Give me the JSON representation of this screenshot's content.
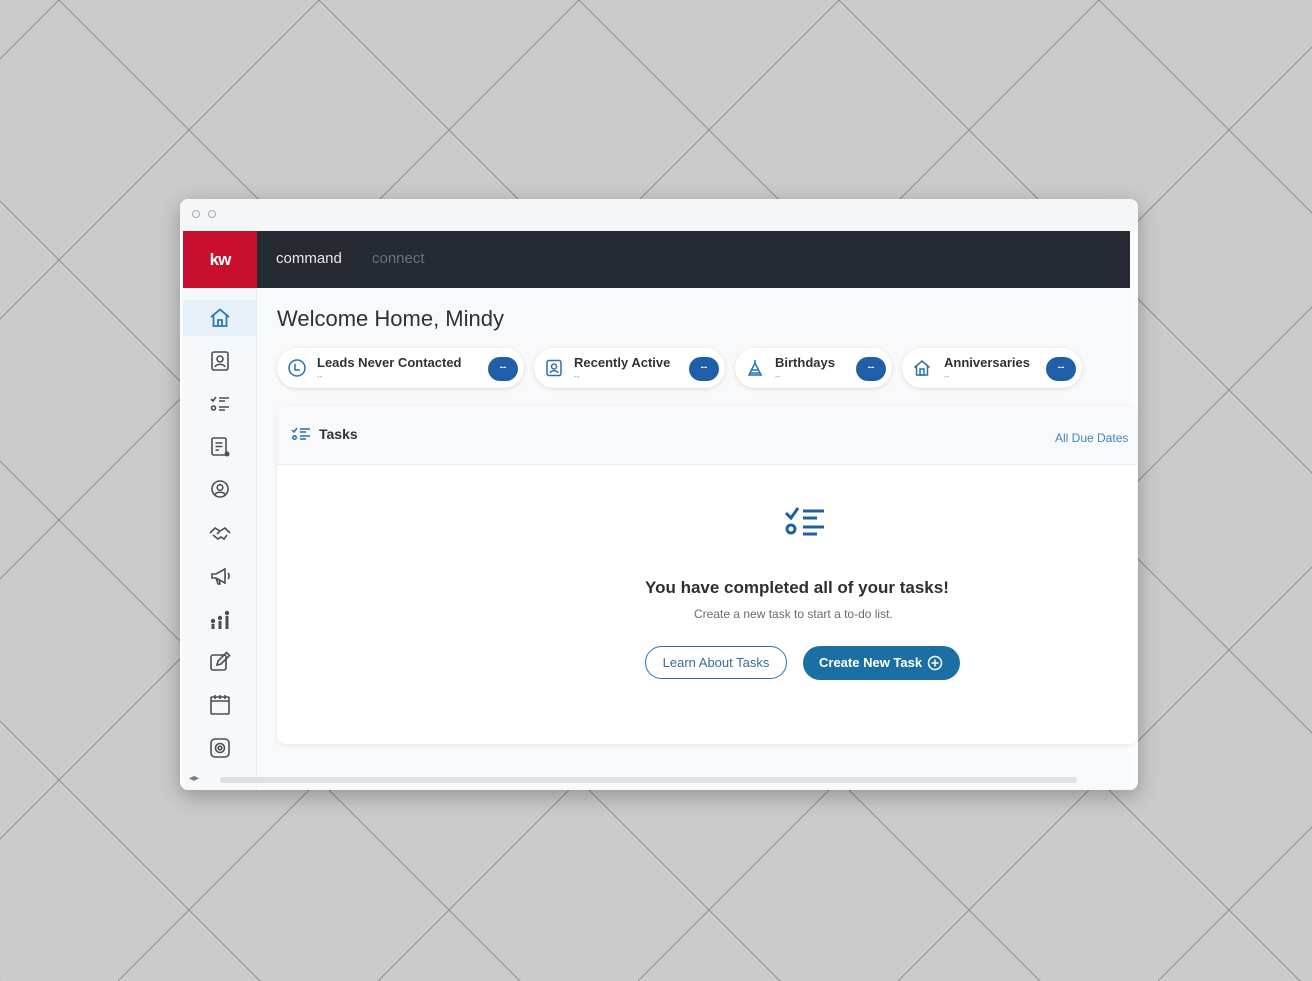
{
  "colors": {
    "brand_red": "#c8102e",
    "topbar": "#262a33",
    "accent_blue": "#1f5fa7",
    "link_blue": "#3f86c6"
  },
  "topbar": {
    "logo": "kw",
    "nav": [
      {
        "label": "command",
        "active": true
      },
      {
        "label": "connect",
        "active": false
      }
    ]
  },
  "sidebar": {
    "items": [
      {
        "icon": "home-icon",
        "active": true
      },
      {
        "icon": "contacts-icon",
        "active": false
      },
      {
        "icon": "tasks-list-icon",
        "active": false
      },
      {
        "icon": "document-icon",
        "active": false
      },
      {
        "icon": "location-pin-icon",
        "active": false
      },
      {
        "icon": "handshake-icon",
        "active": false
      },
      {
        "icon": "megaphone-icon",
        "active": false
      },
      {
        "icon": "analytics-icon",
        "active": false
      },
      {
        "icon": "edit-icon",
        "active": false
      },
      {
        "icon": "calendar-icon",
        "active": false
      },
      {
        "icon": "settings-icon",
        "active": false
      }
    ]
  },
  "main": {
    "welcome": "Welcome Home, Mindy",
    "chips": [
      {
        "label": "Leads Never Contacted",
        "sub": "--",
        "badge": "--",
        "icon": "clock-icon"
      },
      {
        "label": "Recently Active",
        "sub": "--",
        "badge": "--",
        "icon": "contact-card-icon"
      },
      {
        "label": "Birthdays",
        "sub": "--",
        "badge": "--",
        "icon": "cake-icon"
      },
      {
        "label": "Anniversaries",
        "sub": "--",
        "badge": "--",
        "icon": "house-icon"
      }
    ],
    "tasks": {
      "title": "Tasks",
      "filter_link": "All Due Dates",
      "empty_title": "You have completed all of your tasks!",
      "empty_subtitle": "Create a new task to start a to-do list.",
      "learn_button": "Learn About Tasks",
      "create_button": "Create New Task"
    }
  }
}
